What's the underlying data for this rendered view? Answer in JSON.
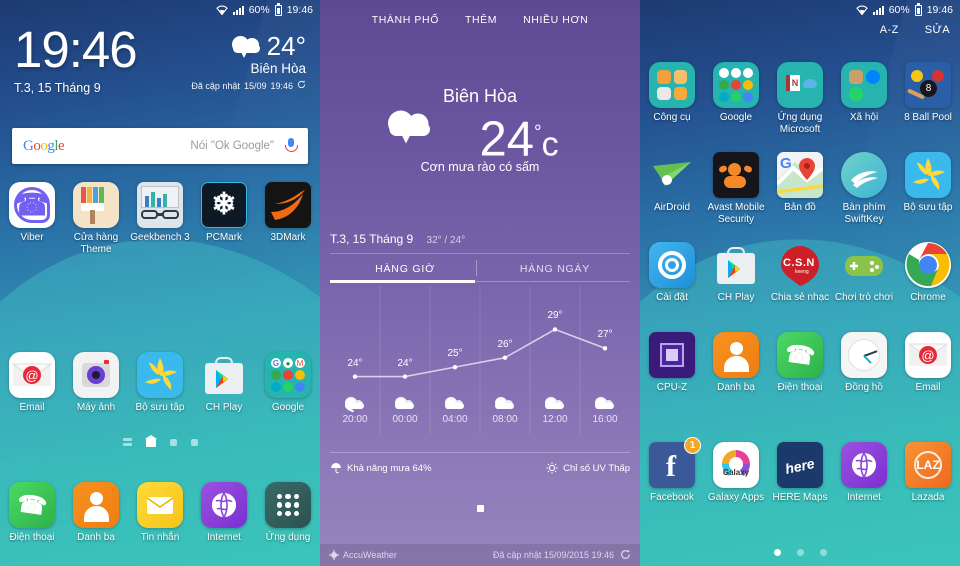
{
  "statusbar": {
    "wifi": "wifi-icon",
    "signal": "signal-icon",
    "battery_pct": "60%",
    "time": "19:46"
  },
  "home": {
    "clock": {
      "time": "19:46",
      "date": "T.3, 15 Tháng 9"
    },
    "weather": {
      "temp": "24°",
      "city": "Biên Hòa",
      "updated_prefix": "Đã cập nhật",
      "updated_date": "15/09",
      "updated_time": "19:46"
    },
    "search": {
      "logo": "Google",
      "placeholder": "Nói \"Ok Google\"",
      "mic": "mic-icon"
    },
    "row1": [
      {
        "label": "Viber",
        "icon": "viber-icon"
      },
      {
        "label": "Cửa hàng Theme",
        "icon": "theme-store-icon"
      },
      {
        "label": "Geekbench 3",
        "icon": "geekbench-icon"
      },
      {
        "label": "PCMark",
        "icon": "pcmark-icon"
      },
      {
        "label": "3DMark",
        "icon": "3dmark-icon"
      }
    ],
    "row2": [
      {
        "label": "Email",
        "icon": "email-icon"
      },
      {
        "label": "Máy ảnh",
        "icon": "camera-icon"
      },
      {
        "label": "Bộ sưu tập",
        "icon": "gallery-icon"
      },
      {
        "label": "CH Play",
        "icon": "play-store-icon"
      },
      {
        "label": "Google",
        "icon": "google-folder-icon"
      }
    ],
    "dock": [
      {
        "label": "Điện thoại",
        "icon": "phone-icon"
      },
      {
        "label": "Danh bạ",
        "icon": "contacts-icon"
      },
      {
        "label": "Tin nhắn",
        "icon": "messages-icon"
      },
      {
        "label": "Internet",
        "icon": "internet-icon"
      },
      {
        "label": "Ứng dụng",
        "icon": "apps-icon"
      }
    ]
  },
  "weather_app": {
    "menu": [
      "THÀNH PHỐ",
      "THÊM",
      "NHIỀU HƠN"
    ],
    "city": "Biên Hòa",
    "temp": "24",
    "unit": "c",
    "degree": "°",
    "condition": "Cơn mưa rào có sấm",
    "date": "T.3, 15 Tháng 9",
    "range": "32° / 24°",
    "tabs": [
      {
        "label": "HÀNG GIỜ",
        "active": true
      },
      {
        "label": "HÀNG NGÀY",
        "active": false
      }
    ],
    "precip": "Khả năng mưa 64%",
    "uv": "Chỉ số UV Thấp",
    "brand": "AccuWeather",
    "updated": "Đã cập nhật  15/09/2015  19:46",
    "refresh": "refresh-icon"
  },
  "chart_data": {
    "type": "line",
    "title": "HÀNG GIỜ",
    "categories": [
      "20:00",
      "00:00",
      "04:00",
      "08:00",
      "12:00",
      "16:00"
    ],
    "values": [
      24,
      24,
      25,
      26,
      29,
      27
    ],
    "labels": [
      "24°",
      "24°",
      "25°",
      "26°",
      "29°",
      "27°"
    ],
    "conditions": [
      "rain-cloud",
      "cloud",
      "cloud",
      "cloud",
      "cloud",
      "cloud"
    ],
    "xlabel": "",
    "ylabel": "",
    "ylim": [
      23,
      30
    ],
    "grid": true,
    "legend": "none",
    "line_color": "#d8d0ea",
    "point_color": "#ffffff"
  },
  "drawer": {
    "sort_label": "A-Z",
    "edit_label": "SỬA",
    "rows": [
      [
        {
          "label": "Công cụ",
          "icon": "tools-folder-icon"
        },
        {
          "label": "Google",
          "icon": "google-folder-icon"
        },
        {
          "label": "Ứng dụng Microsoft",
          "icon": "microsoft-folder-icon"
        },
        {
          "label": "Xã hội",
          "icon": "social-folder-icon"
        },
        {
          "label": "8 Ball Pool",
          "icon": "8-ball-pool-icon"
        }
      ],
      [
        {
          "label": "AirDroid",
          "icon": "airdroid-icon"
        },
        {
          "label": "Avast Mobile Security",
          "icon": "avast-icon"
        },
        {
          "label": "Bản đồ",
          "icon": "google-maps-icon"
        },
        {
          "label": "Bàn phím SwiftKey",
          "icon": "swiftkey-icon"
        },
        {
          "label": "Bộ sưu tập",
          "icon": "gallery-icon"
        }
      ],
      [
        {
          "label": "Cài đặt",
          "icon": "settings-icon"
        },
        {
          "label": "CH Play",
          "icon": "play-store-icon"
        },
        {
          "label": "Chia sẻ nhạc",
          "icon": "csn-music-icon"
        },
        {
          "label": "Chơi trò chơi",
          "icon": "play-games-icon"
        },
        {
          "label": "Chrome",
          "icon": "chrome-icon"
        }
      ],
      [
        {
          "label": "CPU-Z",
          "icon": "cpuz-icon"
        },
        {
          "label": "Danh bạ",
          "icon": "contacts-icon"
        },
        {
          "label": "Điện thoại",
          "icon": "phone-icon"
        },
        {
          "label": "Đồng hồ",
          "icon": "clock-icon"
        },
        {
          "label": "Email",
          "icon": "email-icon"
        }
      ],
      [
        {
          "label": "Facebook",
          "icon": "facebook-icon",
          "badge": "1"
        },
        {
          "label": "Galaxy Apps",
          "icon": "galaxy-apps-icon"
        },
        {
          "label": "HERE Maps",
          "icon": "here-maps-icon"
        },
        {
          "label": "Internet",
          "icon": "internet-icon"
        },
        {
          "label": "Lazada",
          "icon": "lazada-icon"
        }
      ]
    ]
  },
  "colors": {
    "weather_purple": "#7c68ad",
    "wallpaper_top": "#1d3a72",
    "wallpaper_bottom": "#37c2b4",
    "accent_white": "#ffffff",
    "badge_orange": "#f5a623"
  }
}
